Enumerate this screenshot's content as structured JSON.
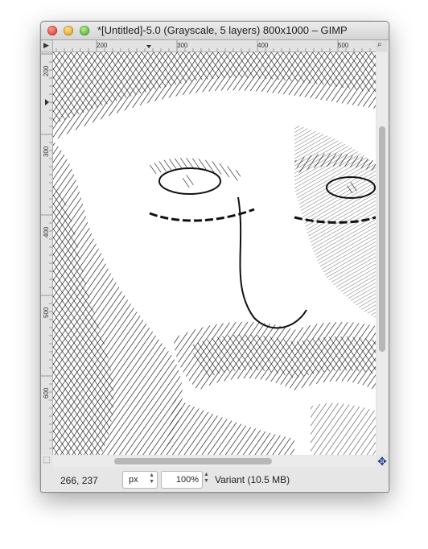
{
  "window": {
    "title": "*[Untitled]-5.0 (Grayscale, 5 layers) 800x1000 – GIMP"
  },
  "rulers": {
    "horizontal_labels": [
      "200",
      "300",
      "400",
      "500"
    ],
    "vertical_labels": [
      "200",
      "300",
      "400",
      "500",
      "600"
    ]
  },
  "icons": {
    "quick_mask": "quick-mask-icon",
    "navigate": "navigate-icon",
    "menu": "menu-arrow-icon"
  },
  "status": {
    "coords": "266, 237",
    "unit": "px",
    "zoom": "100%",
    "layer_info": "Variant (10.5 MB)"
  },
  "colors": {
    "canvas_ink": "#111111",
    "canvas_bg": "#ffffff",
    "navigate": "#1a3a8c"
  }
}
